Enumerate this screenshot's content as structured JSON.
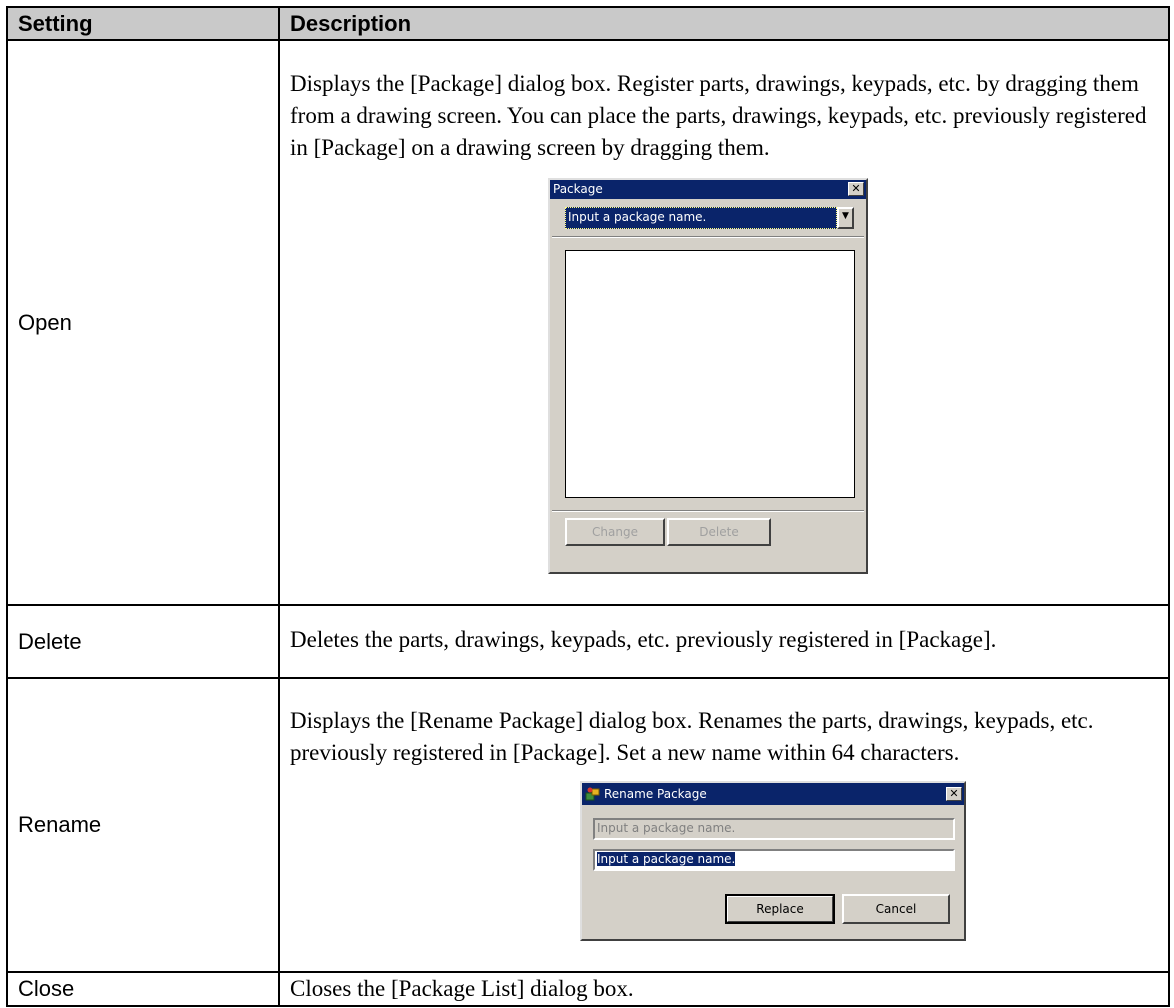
{
  "table": {
    "header": {
      "setting": "Setting",
      "description": "Description"
    },
    "rows": [
      {
        "setting": "Open",
        "description": "Displays the [Package] dialog box. Register parts, drawings, keypads, etc. by dragging them from a drawing screen. You can place the parts, drawings, keypads, etc. previously registered in [Package] on a drawing screen by dragging them."
      },
      {
        "setting": "Delete",
        "description": "Deletes the parts, drawings, keypads, etc. previously registered in [Package]."
      },
      {
        "setting": "Rename",
        "description": "Displays the [Rename Package] dialog box. Renames the parts, drawings, keypads, etc. previously registered in [Package]. Set a new name within 64 characters."
      },
      {
        "setting": "Close",
        "description": "Closes the [Package List] dialog box."
      }
    ]
  },
  "package_dialog": {
    "title": "Package",
    "combo_value": "Input a package name.",
    "change_label": "Change",
    "delete_label": "Delete"
  },
  "rename_dialog": {
    "title": "Rename Package",
    "current_name": "Input a package name.",
    "new_name": "Input a package name.",
    "replace_label": "Replace",
    "cancel_label": "Cancel"
  },
  "icons": {
    "close": "close-icon",
    "dropdown": "chevron-down-icon",
    "app": "package-app-icon"
  },
  "colors": {
    "header_bg": "#c9c9c9",
    "titlebar": "#0a246a",
    "dialog_face": "#d4d0c8"
  }
}
